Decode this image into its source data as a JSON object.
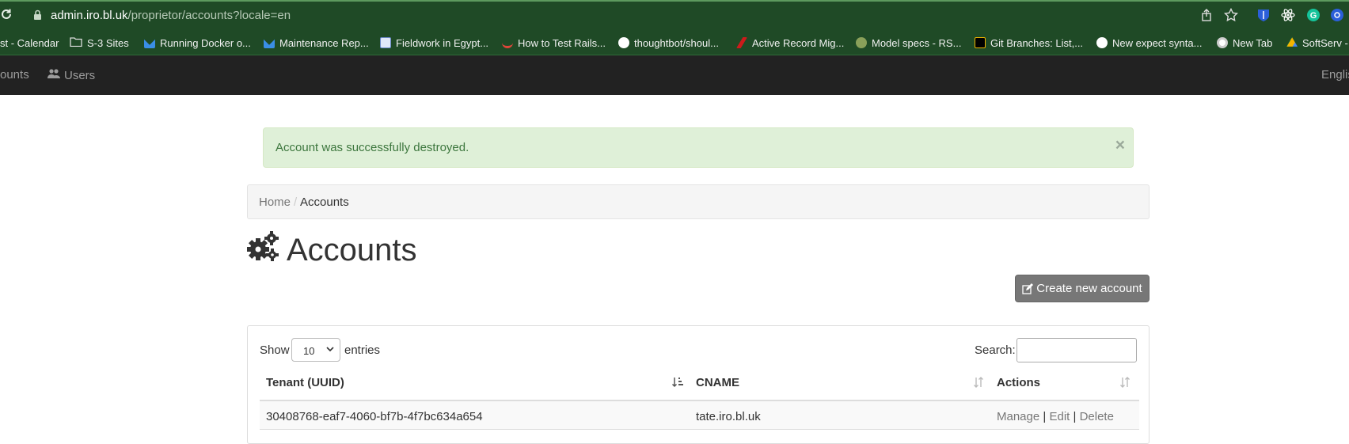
{
  "browser": {
    "url_host": "admin.iro.bl.uk",
    "url_path": "/proprietor/accounts?locale=en",
    "bookmarks": [
      {
        "label": "st - Calendar",
        "icon": "none"
      },
      {
        "label": "S-3 Sites",
        "icon": "folder-icon"
      },
      {
        "label": "Running Docker o...",
        "icon": "site-icon"
      },
      {
        "label": "Maintenance Rep...",
        "icon": "site-icon"
      },
      {
        "label": "Fieldwork in Egypt...",
        "icon": "site-icon"
      },
      {
        "label": "How to Test Rails...",
        "icon": "site-icon"
      },
      {
        "label": "thoughtbot/shoul...",
        "icon": "github-icon"
      },
      {
        "label": "Active Record Mig...",
        "icon": "site-icon"
      },
      {
        "label": "Model specs - RS...",
        "icon": "site-icon"
      },
      {
        "label": "Git Branches: List,...",
        "icon": "site-icon"
      },
      {
        "label": "New expect synta...",
        "icon": "github-icon"
      },
      {
        "label": "New Tab",
        "icon": "globe-icon"
      },
      {
        "label": "SoftServ -",
        "icon": "drive-icon"
      }
    ]
  },
  "nav": {
    "accounts_label": "ounts",
    "users_label": "Users",
    "language_label": "Englis"
  },
  "alert": {
    "message": "Account was successfully destroyed.",
    "close": "×"
  },
  "breadcrumb": {
    "home": "Home",
    "separator": "/",
    "current": "Accounts"
  },
  "page": {
    "title": "Accounts",
    "create_button": "Create new account"
  },
  "table_controls": {
    "show_label": "Show",
    "entries_value": "10",
    "entries_label": "entries",
    "search_label": "Search:"
  },
  "table": {
    "columns": [
      "Tenant (UUID)",
      "CNAME",
      "Actions"
    ],
    "rows": [
      {
        "tenant": "30408768-eaf7-4060-bf7b-4f7bc634a654",
        "cname": "tate.iro.bl.uk",
        "manage": "Manage",
        "edit": "Edit",
        "delete": "Delete",
        "sep": "|"
      }
    ]
  },
  "colors": {
    "browser_bar": "#1f4a26",
    "navbar": "#222222",
    "alert_bg": "#dff0d8",
    "alert_text": "#3c763d",
    "button_bg": "#777777"
  }
}
